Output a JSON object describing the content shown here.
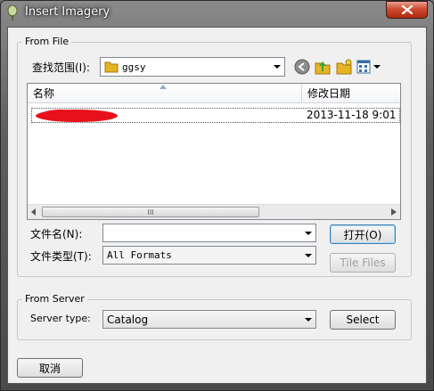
{
  "window": {
    "title": "Insert Imagery"
  },
  "from_file": {
    "group_label": "From File",
    "look_in_label": "查找范围(I):",
    "look_in_value": "ggsy",
    "columns": {
      "name": "名称",
      "date": "修改日期"
    },
    "rows": [
      {
        "name": "",
        "date": "2013-11-18 9:01"
      }
    ],
    "file_name_label": "文件名(N):",
    "file_name_value": "",
    "file_type_label": "文件类型(T):",
    "file_type_value": "All Formats",
    "open_label": "打开(O)",
    "tile_files_label": "Tile Files",
    "scroll_grip": "III"
  },
  "from_server": {
    "group_label": "From Server",
    "server_type_label": "Server type:",
    "server_type_value": "Catalog",
    "select_label": "Select"
  },
  "footer": {
    "cancel_label": "取消"
  },
  "colors": {
    "redaction": "#e8101a",
    "folder": "#e6b422",
    "selection": "#3c7fb1"
  }
}
